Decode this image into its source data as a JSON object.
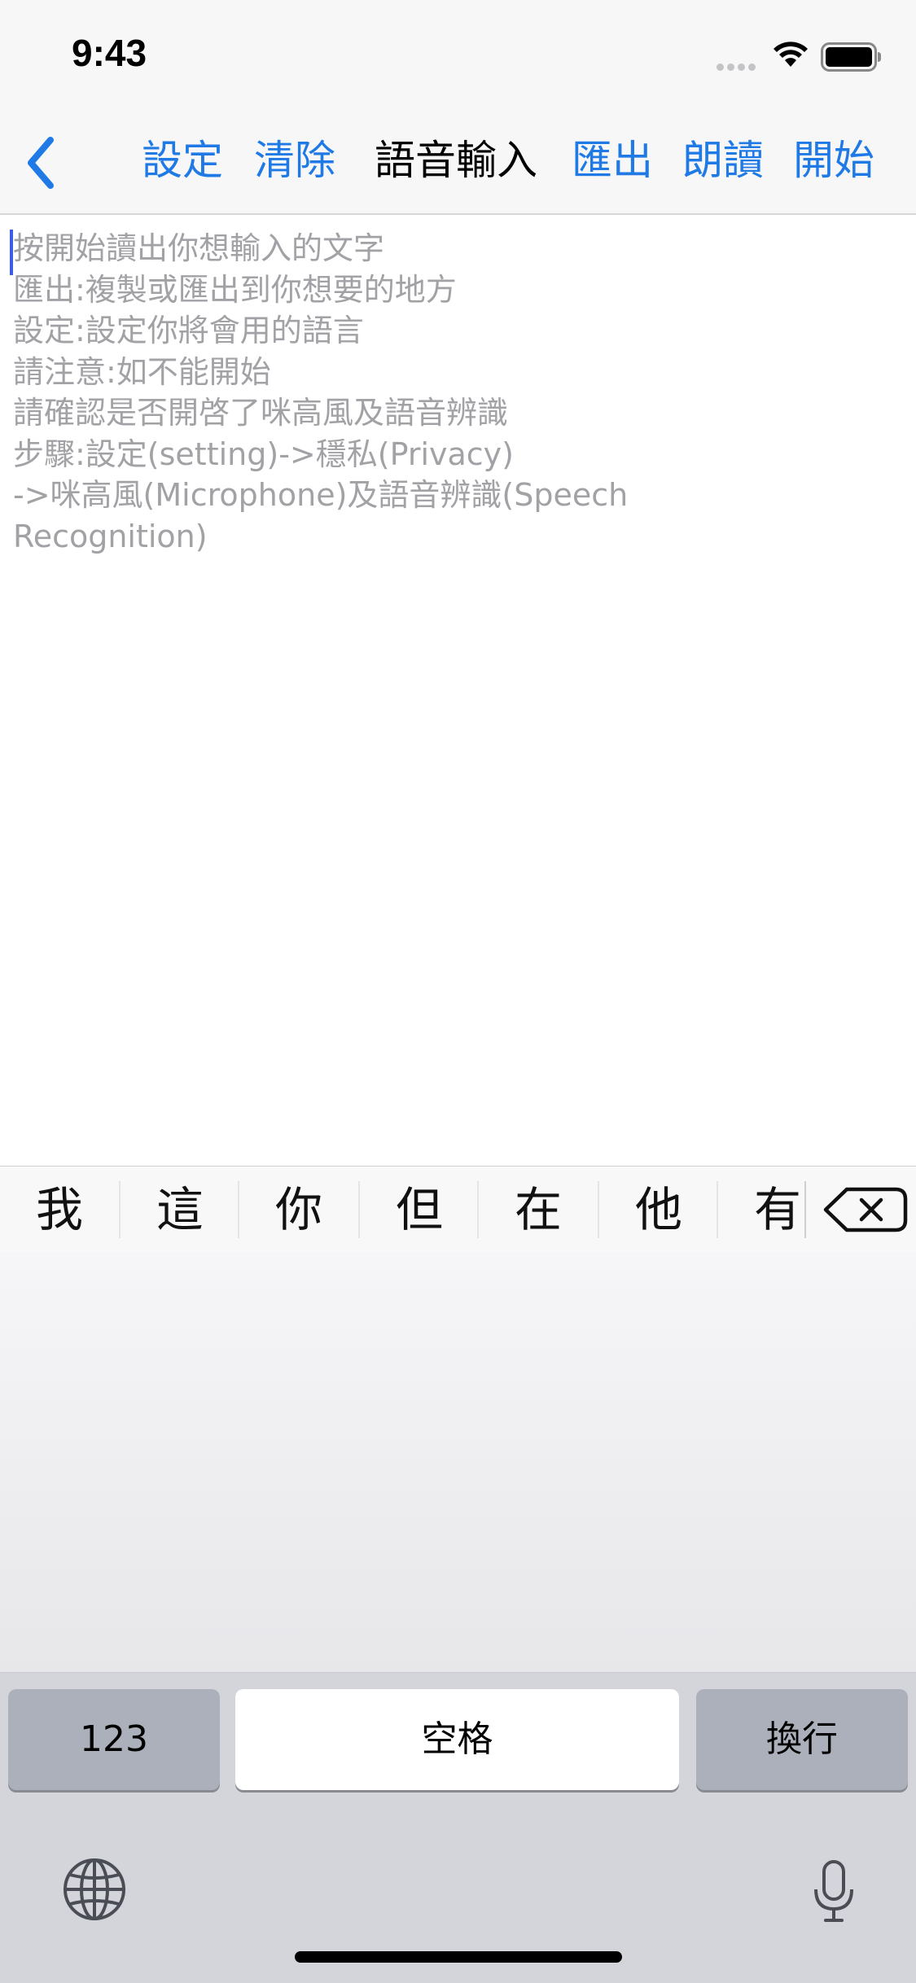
{
  "status": {
    "time": "9:43"
  },
  "nav": {
    "settings": "設定",
    "clear": "清除",
    "title": "語音輸入",
    "export": "匯出",
    "read_aloud": "朗讀",
    "start": "開始"
  },
  "editor": {
    "placeholder_lines": [
      "按開始讀出你想輸入的文字",
      "匯出:複製或匯出到你想要的地方",
      "設定:設定你將會用的語言",
      "請注意:如不能開始",
      "請確認是否開啓了咪高風及語音辨識",
      "步驟:設定(setting)->穩私(Privacy)",
      "->咪高風(Microphone)及語音辨識(Speech Recognition)"
    ]
  },
  "candidates": [
    "我",
    "這",
    "你",
    "但",
    "在",
    "他",
    "有"
  ],
  "keyboard": {
    "numbers_key": "123",
    "space_key": "空格",
    "return_key": "換行"
  },
  "icons": {
    "back": "chevron-left-icon",
    "wifi": "wifi-icon",
    "battery": "battery-icon",
    "signal": "signal-dots-icon",
    "delete": "backspace-icon",
    "globe": "globe-icon",
    "mic": "microphone-icon"
  },
  "colors": {
    "accent": "#1f7ae6",
    "placeholder": "#a2a2a6",
    "cursor": "#3c5ee6"
  }
}
